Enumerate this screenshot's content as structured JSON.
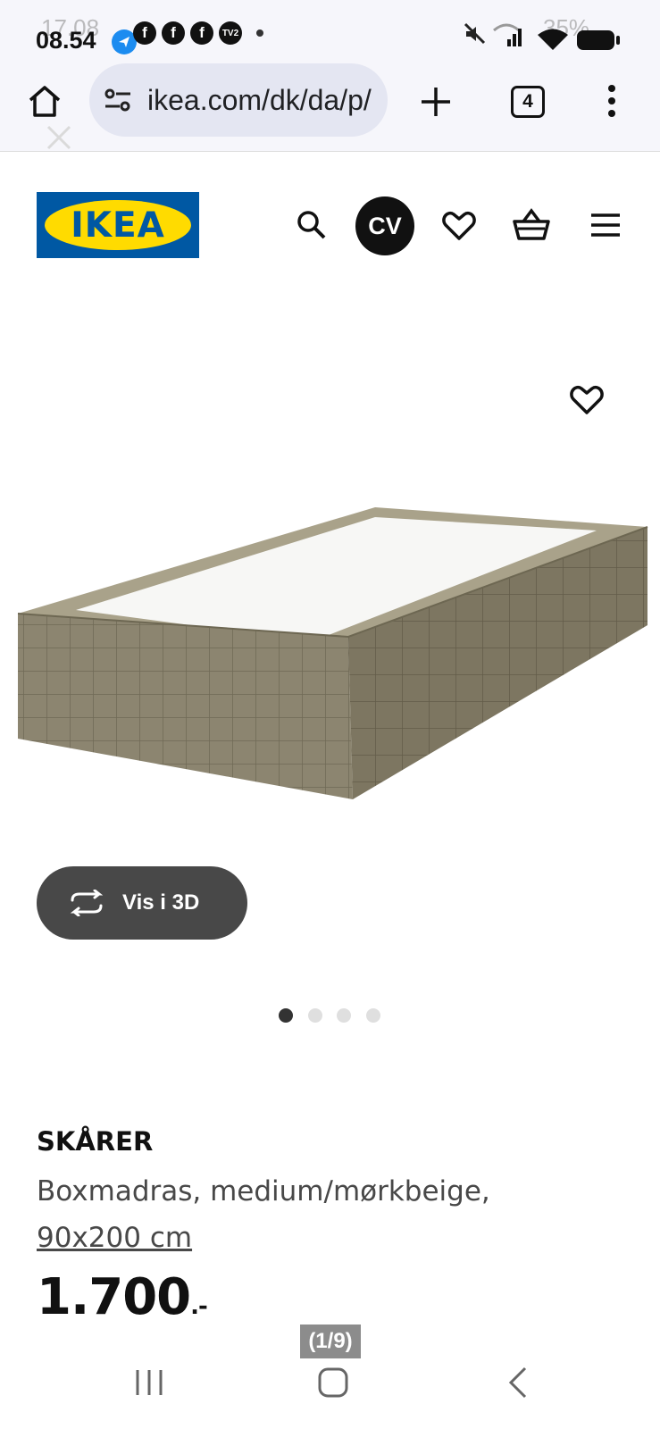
{
  "status_bar": {
    "time": "08.54",
    "ghost_time": "17.08",
    "battery": "35%",
    "notification_icons": [
      "telegram-icon",
      "facebook-icon",
      "facebook-icon",
      "facebook-icon",
      "tv2-icon"
    ]
  },
  "browser": {
    "url": "ikea.com/dk/da/p/",
    "tab_count": "4"
  },
  "header": {
    "logo_text": "IKEA",
    "avatar_initials": "CV"
  },
  "product": {
    "view_3d_label": "Vis i 3D",
    "image_count": 4,
    "active_image": 1,
    "name": "SKÅRER",
    "description": "Boxmadras, medium/mørkbeige,",
    "size": "90x200 cm",
    "price": "1.700",
    "price_suffix": ".-"
  },
  "overlay": {
    "page_counter": "(1/9)"
  },
  "colors": {
    "ikea_blue": "#0058a3",
    "ikea_yellow": "#ffdb00",
    "button_dark": "#484848"
  }
}
